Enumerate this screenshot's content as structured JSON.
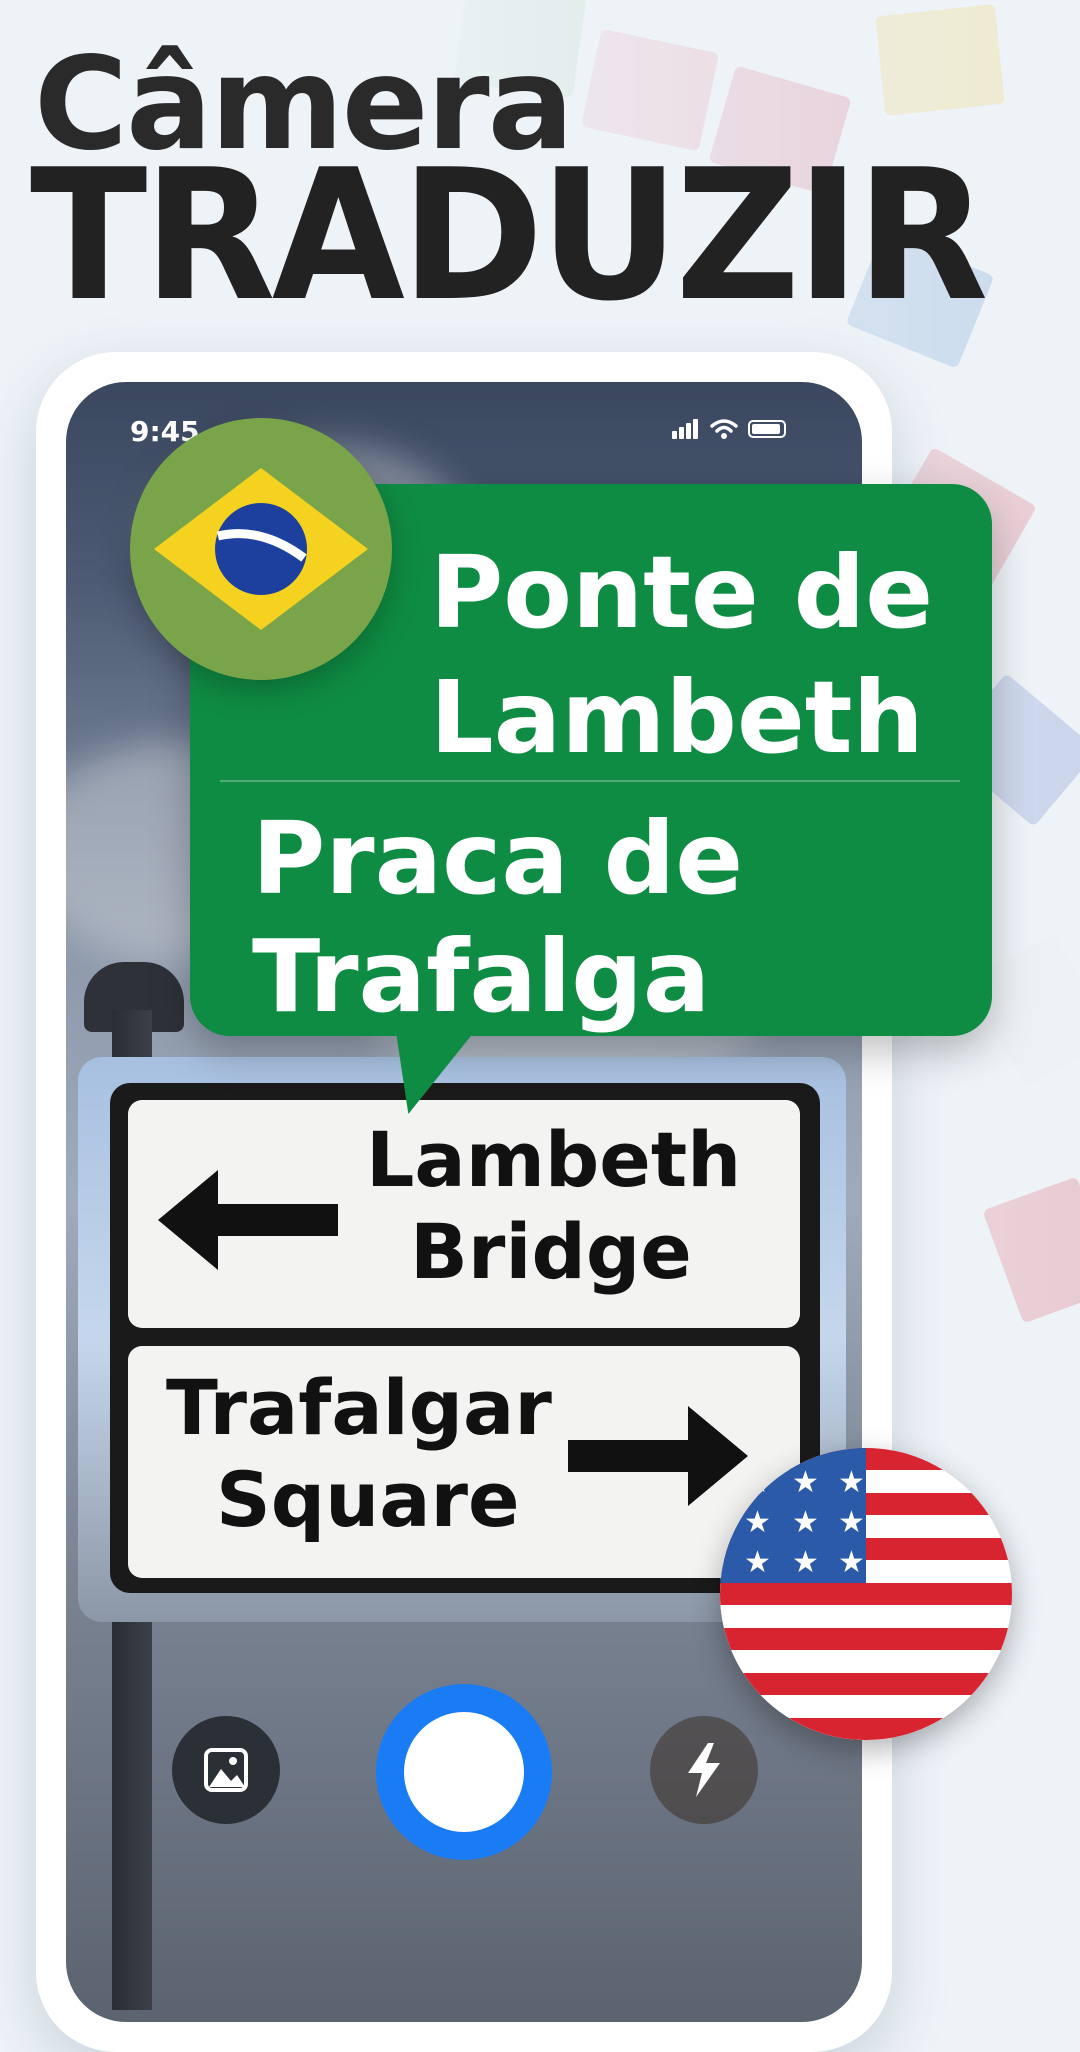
{
  "headline": {
    "line1": "Câmera",
    "line2": "TRADUZIR"
  },
  "status_bar": {
    "time": "9:45",
    "icons": [
      "signal-icon",
      "wifi-icon",
      "battery-icon"
    ]
  },
  "translation_bubble": {
    "line1": "Ponte de Lambeth",
    "line2": "Praca de Trafalga",
    "color": "#0f8c43"
  },
  "source_sign": {
    "top_text_1": "Lambeth",
    "top_text_2": "Bridge",
    "bottom_text_1": "Trafalgar",
    "bottom_text_2": "Square"
  },
  "languages": {
    "target_flag": "brazil-flag-icon",
    "source_flag": "usa-flag-icon"
  },
  "camera_controls": {
    "gallery_icon": "image-icon",
    "shutter_color": "#1a7cf5",
    "flash_icon": "flash-icon"
  }
}
